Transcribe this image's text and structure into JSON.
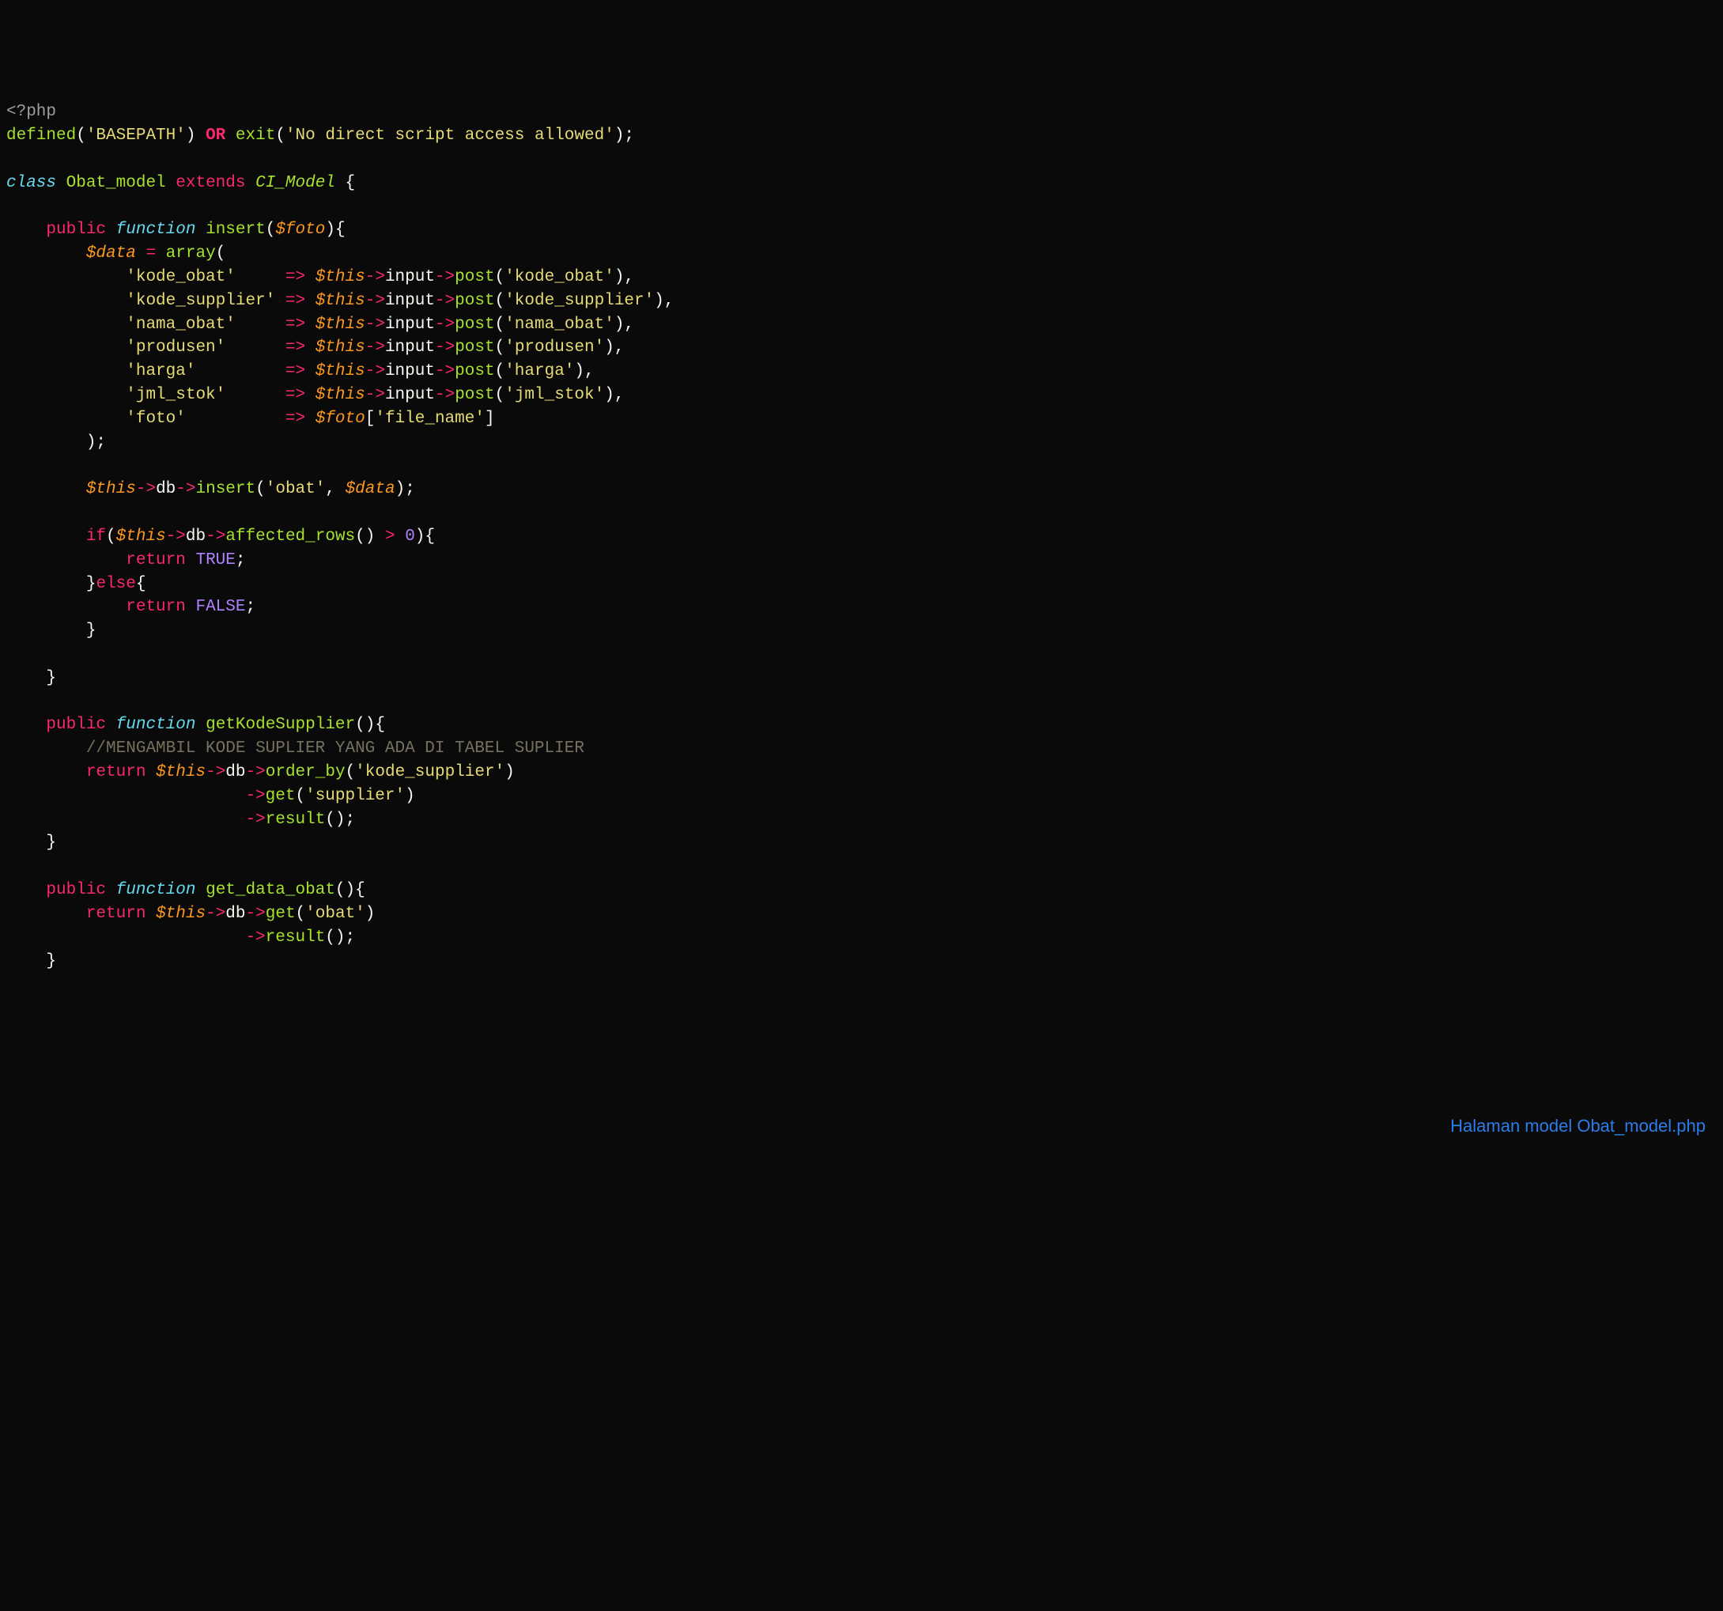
{
  "caption": "Halaman model Obat_model.php",
  "code": {
    "php_open": "<?php",
    "defined_fn": "defined",
    "basepath_str": "'BASEPATH'",
    "or_kw": "OR",
    "exit_fn": "exit",
    "exit_str": "'No direct script access allowed'",
    "class_kw": "class",
    "class_name": "Obat_model",
    "extends_kw": "extends",
    "parent_class": "CI_Model",
    "public_kw": "public",
    "function_kw": "function",
    "insert_fn": "insert",
    "foto_var": "$foto",
    "data_var": "$data",
    "array_fn": "array",
    "k_kode_obat": "'kode_obat'",
    "k_kode_supplier": "'kode_supplier'",
    "k_nama_obat": "'nama_obat'",
    "k_produsen": "'produsen'",
    "k_harga": "'harga'",
    "k_jml_stok": "'jml_stok'",
    "k_foto": "'foto'",
    "this": "$this",
    "input": "input",
    "post": "post",
    "p_kode_obat": "'kode_obat'",
    "p_kode_supplier": "'kode_supplier'",
    "p_nama_obat": "'nama_obat'",
    "p_produsen": "'produsen'",
    "p_harga": "'harga'",
    "p_jml_stok": "'jml_stok'",
    "file_name": "'file_name'",
    "db": "db",
    "insert_db": "insert",
    "obat_str": "'obat'",
    "if_kw": "if",
    "affected_rows": "affected_rows",
    "zero": "0",
    "return_kw": "return",
    "true_const": "TRUE",
    "else_kw": "else",
    "false_const": "FALSE",
    "getKodeSupplier": "getKodeSupplier",
    "comment_line": "//MENGAMBIL KODE SUPLIER YANG ADA DI TABEL SUPLIER",
    "order_by": "order_by",
    "kode_supplier_str": "'kode_supplier'",
    "get_fn": "get",
    "supplier_str": "'supplier'",
    "result_fn": "result",
    "get_data_obat": "get_data_obat"
  }
}
